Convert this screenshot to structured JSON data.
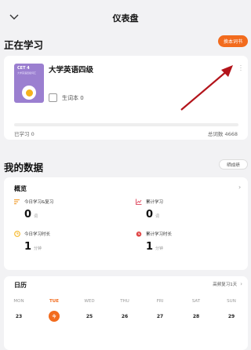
{
  "header": {
    "title": "仪表盘",
    "back_icon": "chevron-down-icon"
  },
  "studying": {
    "section_title": "正在学习",
    "switch_button": "换本词书",
    "book": {
      "cover_title": "CET 4",
      "cover_subtitle": "大学英语四级词汇",
      "name": "大学英语四级",
      "new_words_label": "生词本 0"
    },
    "progress": {
      "learned_label": "已学习 0",
      "total_label": "总词数 4668",
      "fraction": 0
    }
  },
  "my_data": {
    "section_title": "我的数据",
    "achievement_button": "晒成绩",
    "overview": {
      "title": "概览",
      "stats": [
        {
          "label": "今日学习&复习",
          "value": "0",
          "unit": "词",
          "icon": "list-icon",
          "color": "#f2a33a"
        },
        {
          "label": "累计学习",
          "value": "0",
          "unit": "词",
          "icon": "trend-chart-icon",
          "color": "#e0566a"
        },
        {
          "label": "今日学习时长",
          "value": "1",
          "unit": "分钟",
          "icon": "clock-icon",
          "color": "#f5b625"
        },
        {
          "label": "累计学习时长",
          "value": "1",
          "unit": "分钟",
          "icon": "alarm-clock-icon",
          "color": "#e04848"
        }
      ]
    },
    "calendar": {
      "title": "日历",
      "streak_label": "高频复习1天",
      "weekdays": [
        "MON",
        "TUE",
        "WED",
        "THU",
        "FRI",
        "SAT",
        "SUN"
      ],
      "dates": [
        "23",
        "今",
        "25",
        "26",
        "27",
        "28",
        "29"
      ],
      "today_index": 1
    }
  },
  "colors": {
    "accent": "#f26b1d",
    "annotation_arrow": "#b3141b",
    "book_cover": "#9b7fd0"
  }
}
